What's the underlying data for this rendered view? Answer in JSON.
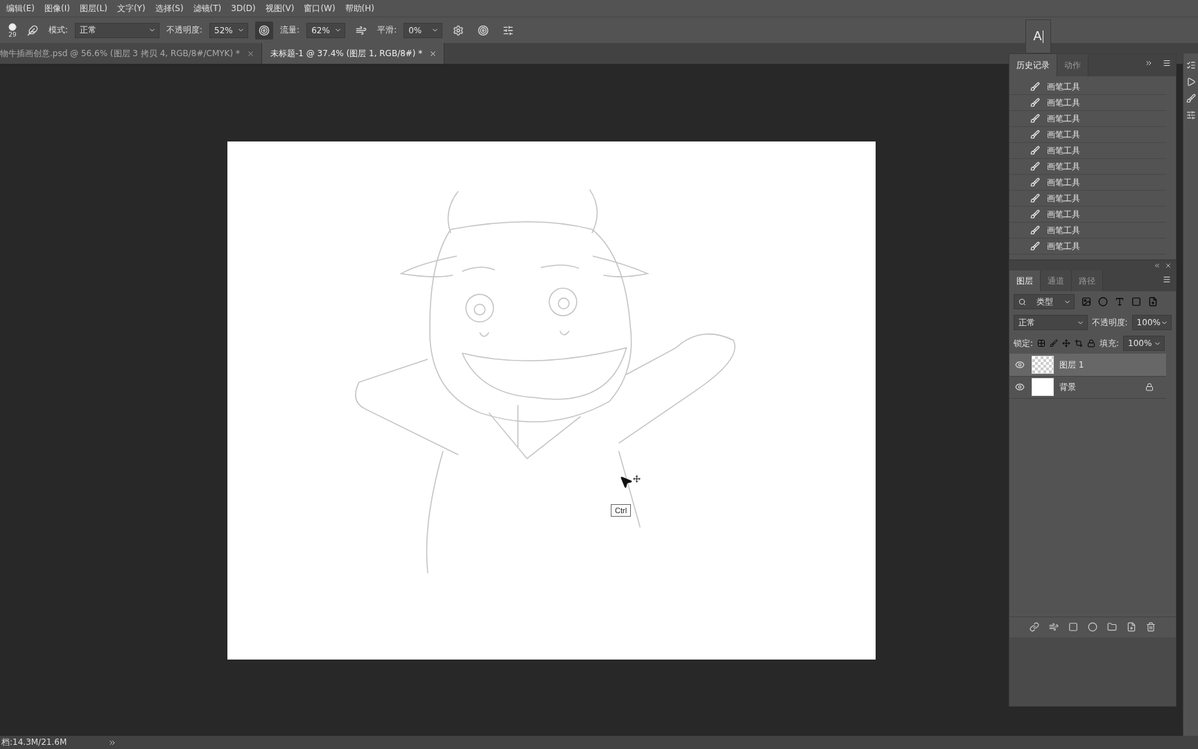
{
  "menu": [
    "编辑(E)",
    "图像(I)",
    "图层(L)",
    "文字(Y)",
    "选择(S)",
    "滤镜(T)",
    "3D(D)",
    "视图(V)",
    "窗口(W)",
    "帮助(H)"
  ],
  "options_bar": {
    "brush_size": "29",
    "mode_label": "模式:",
    "mode": "正常",
    "opacity_label": "不透明度:",
    "opacity": "52%",
    "flow_label": "流量:",
    "flow": "62%",
    "smoothing_label": "平滑:",
    "smoothing": "0%"
  },
  "document_tabs": [
    {
      "title": "物牛插画创意.psd @ 56.6% (图层 3 拷贝 4, RGB/8#/CMYK) *",
      "selected": false
    },
    {
      "title": "未标题-1 @ 37.4% (图层 1, RGB/8#) *",
      "selected": true
    }
  ],
  "character_panel": {
    "glyph": "A"
  },
  "history_panel": {
    "tabs": [
      {
        "label": "历史记录",
        "selected": true
      },
      {
        "label": "动作",
        "selected": false
      }
    ],
    "items": [
      {
        "label": "画笔工具"
      },
      {
        "label": "画笔工具"
      },
      {
        "label": "画笔工具"
      },
      {
        "label": "画笔工具"
      },
      {
        "label": "画笔工具"
      },
      {
        "label": "画笔工具"
      },
      {
        "label": "画笔工具"
      },
      {
        "label": "画笔工具"
      },
      {
        "label": "画笔工具"
      },
      {
        "label": "画笔工具"
      },
      {
        "label": "画笔工具"
      }
    ]
  },
  "layers_panel": {
    "tabs": [
      {
        "label": "图层",
        "selected": true
      },
      {
        "label": "通道",
        "selected": false
      },
      {
        "label": "路径",
        "selected": false
      }
    ],
    "filter": "类型",
    "blend_mode": "正常",
    "opacity_label": "不透明度:",
    "opacity": "100%",
    "lock_label": "锁定:",
    "fill_label": "填充:",
    "fill": "100%",
    "layers": [
      {
        "name": "图层 1",
        "kind": "transparent",
        "selected": true,
        "visible": true,
        "locked": false
      },
      {
        "name": "背景",
        "kind": "white",
        "selected": false,
        "visible": true,
        "locked": true
      }
    ]
  },
  "tooltip": "Ctrl",
  "status_bar": {
    "doc_size": "档:14.3M/21.6M"
  }
}
